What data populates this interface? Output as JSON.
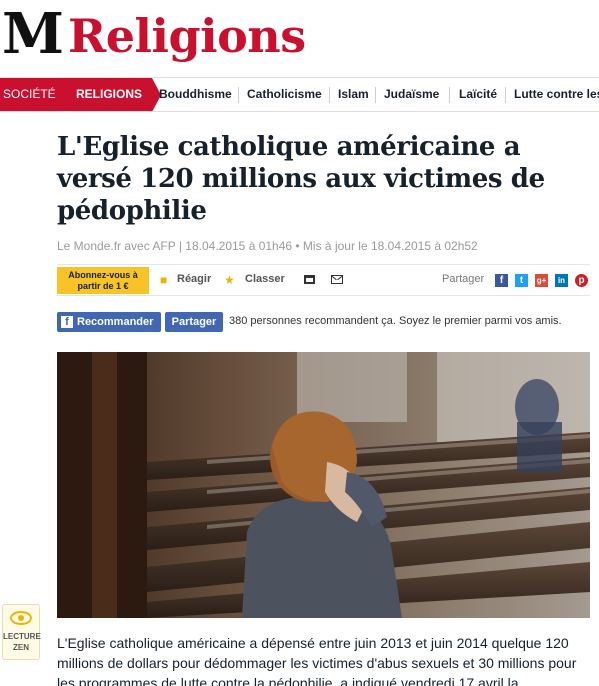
{
  "header": {
    "logo": "M",
    "section_title": "Religions"
  },
  "nav": {
    "items": [
      {
        "label": "SOCIÉTÉ",
        "active": false,
        "style": "section"
      },
      {
        "label": "RELIGIONS",
        "active": true,
        "style": "section"
      },
      {
        "label": "Bouddhisme"
      },
      {
        "label": "Catholicisme"
      },
      {
        "label": "Islam"
      },
      {
        "label": "Judaïsme"
      },
      {
        "label": "Laïcité"
      },
      {
        "label": "Lutte contre les"
      }
    ]
  },
  "article": {
    "headline": "L'Eglise catholique américaine a versé 120 millions aux victimes de pédophilie",
    "byline": "Le Monde.fr avec AFP | 18.04.2015 à 01h46 • Mis à jour le 18.04.2015 à 02h52",
    "body": "L'Eglise catholique américaine a dépensé entre juin 2013 et juin 2014 quelque 120 millions de dollars pour dédommager les victimes d'abus sexuels et 30 millions pour les programmes de lutte contre la pédophilie, a indiqué vendredi 17 avril la"
  },
  "toolbar": {
    "subscribe_label": "Abonnez-vous à partir de 1 €",
    "react_label": "Réagir",
    "classify_label": "Classer",
    "share_label": "Partager",
    "icons": [
      "comment-icon",
      "star-icon",
      "print-icon",
      "mail-icon"
    ],
    "social": [
      {
        "name": "facebook-icon",
        "glyph": "f",
        "color": "#3b5998"
      },
      {
        "name": "twitter-icon",
        "glyph": "t",
        "color": "#1da1f2"
      },
      {
        "name": "google-plus-icon",
        "glyph": "g+",
        "color": "#dd4b39"
      },
      {
        "name": "linkedin-icon",
        "glyph": "in",
        "color": "#0077b5"
      },
      {
        "name": "pinterest-icon",
        "glyph": "p",
        "color": "#cb2027"
      }
    ],
    "accent_color": "#f8c326"
  },
  "facebook": {
    "recommend_label": "Recommander",
    "share_label": "Partager",
    "social_text": "380 personnes recommandent ça. Soyez le premier parmi vos amis."
  },
  "zen": {
    "label": "LECTURE ZEN"
  },
  "colors": {
    "brand_red": "#c9102f",
    "text": "#16212c",
    "facebook_blue": "#4267b2"
  }
}
